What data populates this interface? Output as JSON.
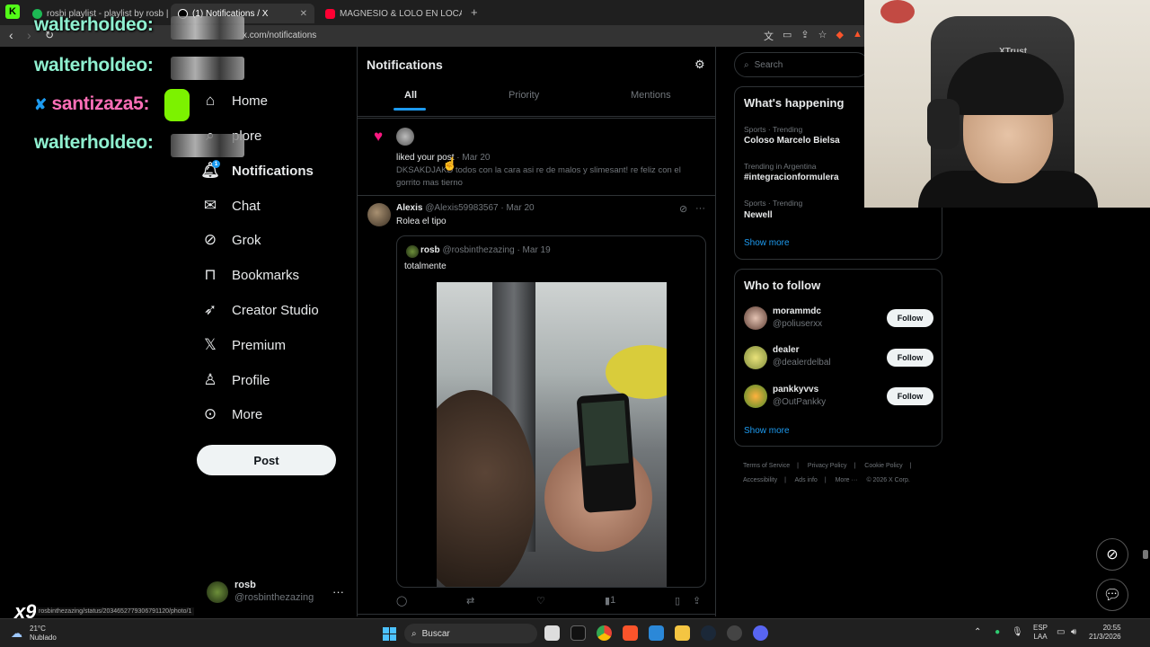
{
  "browser": {
    "tabs": [
      {
        "label": "rosbi playlist - playlist by rosb | Spoti",
        "color": "#1db954"
      },
      {
        "label": "(1) Notifications / X",
        "color": "#ffffff"
      },
      {
        "label": "MAGNESIO & LOLO EN LOCAL SI",
        "color": "#ff0033"
      }
    ],
    "url": "x.com/notifications"
  },
  "overlay_chat": [
    {
      "user": "walterholdeo:"
    },
    {
      "user": "walterholdeo:"
    },
    {
      "user": "santizaza5:"
    },
    {
      "user": "walterholdeo:"
    }
  ],
  "nav": {
    "items": [
      {
        "label": "Home",
        "icon": "home-icon"
      },
      {
        "label": "plore",
        "icon": "search-icon"
      },
      {
        "label": "Notifications",
        "icon": "bell-icon"
      },
      {
        "label": "Chat",
        "icon": "mail-icon"
      },
      {
        "label": "Grok",
        "icon": "grok-icon"
      },
      {
        "label": "Bookmarks",
        "icon": "bookmark-icon"
      },
      {
        "label": "Creator Studio",
        "icon": "rocket-icon"
      },
      {
        "label": "Premium",
        "icon": "x-logo-icon"
      },
      {
        "label": "Profile",
        "icon": "person-icon"
      },
      {
        "label": "More",
        "icon": "more-circle-icon"
      }
    ],
    "notif_badge": "1",
    "post_label": "Post",
    "account": {
      "name": "rosb",
      "handle": "@rosbinthezazing"
    }
  },
  "main": {
    "title": "Notifications",
    "tabs": [
      "All",
      "Priority",
      "Mentions"
    ],
    "like_notification": {
      "text": "liked your post",
      "date": "· Mar 20",
      "body": "DKSAKDJAKD todos con la cara asi re de malos y slimesant! re feliz con el gorrito mas tierno"
    },
    "tweet": {
      "name": "Alexis",
      "handle": "@Alexis59983567",
      "date": "· Mar 20",
      "text": "Rolea el tipo",
      "quote": {
        "name": "rosb",
        "handle": "@rosbinthezazing",
        "date": "· Mar 19",
        "text": "totalmente"
      },
      "views": "1"
    }
  },
  "right": {
    "search_placeholder": "Search",
    "happening_title": "What's happening",
    "trends": [
      {
        "meta": "Sports · Trending",
        "name": "Coloso Marcelo Bielsa"
      },
      {
        "meta": "Trending in Argentina",
        "name": "#integracionformulera"
      },
      {
        "meta": "Sports · Trending",
        "name": "Newell"
      }
    ],
    "show_more": "Show more",
    "who_to_follow_title": "Who to follow",
    "who_to_follow": [
      {
        "name": "morammdc",
        "handle": "@poliuserxx",
        "follow": "Follow"
      },
      {
        "name": "dealer",
        "handle": "@dealerdelbal",
        "follow": "Follow"
      },
      {
        "name": "pankkyvvs",
        "handle": "@OutPankky",
        "follow": "Follow"
      }
    ],
    "footer": [
      "Terms of Service",
      "|",
      "Privacy Policy",
      "|",
      "Cookie Policy",
      "|",
      "Accessibility",
      "|",
      "Ads info",
      "|",
      "More ···",
      "© 2026 X Corp."
    ]
  },
  "webcam": {
    "brand": "XTrust"
  },
  "overlay_multiplier": "x9",
  "status_url": "rosbinthezazing/status/2034652779306791120/photo/1",
  "taskbar": {
    "temp": "21°C",
    "weather": "Nublado",
    "search": "Buscar",
    "lang1": "ESP",
    "lang2": "LAA",
    "time": "20:55",
    "date": "21/3/2026"
  }
}
